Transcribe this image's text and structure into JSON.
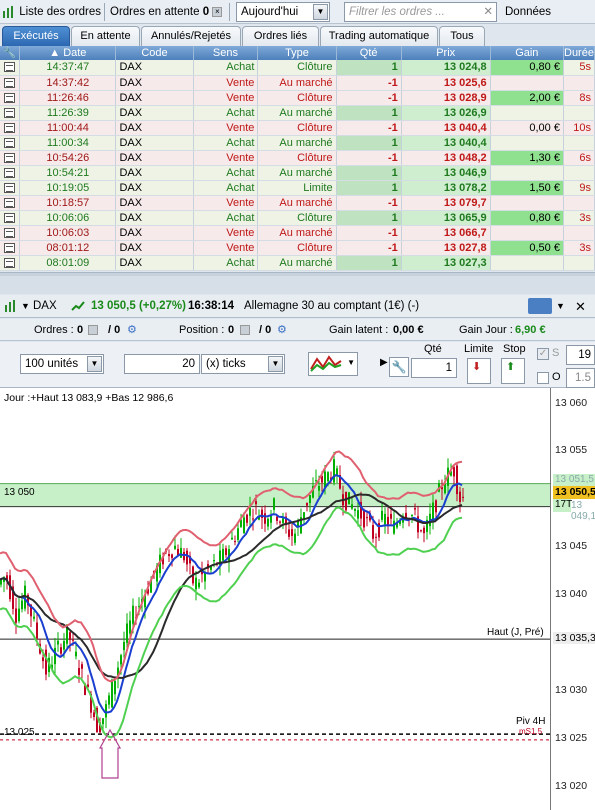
{
  "topbar": {
    "orders_list": "Liste des ordres",
    "pending_label": "Ordres en attente",
    "pending_count": "0",
    "period": "Aujourd'hui",
    "filter_placeholder": "Filtrer les ordres ...",
    "data_label": "Données"
  },
  "tabs": [
    "Exécutés",
    "En attente",
    "Annulés/Rejetés",
    "Ordres liés",
    "Trading automatique",
    "Tous"
  ],
  "table": {
    "headers": [
      "Date",
      "Code",
      "Sens",
      "Type",
      "Qté",
      "Prix",
      "Gain",
      "Durée"
    ],
    "rows": [
      {
        "time": "14:37:47",
        "code": "DAX",
        "dir": "Achat",
        "type": "Clôture",
        "qty": "1",
        "price": "13 024,8",
        "gain": "0,80 €",
        "dur": "5s",
        "side": "buy"
      },
      {
        "time": "14:37:42",
        "code": "DAX",
        "dir": "Vente",
        "type": "Au marché",
        "qty": "-1",
        "price": "13 025,6",
        "gain": "",
        "dur": "",
        "side": "sell"
      },
      {
        "time": "11:26:46",
        "code": "DAX",
        "dir": "Vente",
        "type": "Clôture",
        "qty": "-1",
        "price": "13 028,9",
        "gain": "2,00 €",
        "dur": "8s",
        "side": "sell"
      },
      {
        "time": "11:26:39",
        "code": "DAX",
        "dir": "Achat",
        "type": "Au marché",
        "qty": "1",
        "price": "13 026,9",
        "gain": "",
        "dur": "",
        "side": "buy"
      },
      {
        "time": "11:00:44",
        "code": "DAX",
        "dir": "Vente",
        "type": "Clôture",
        "qty": "-1",
        "price": "13 040,4",
        "gain": "0,00 €",
        "dur": "10s",
        "side": "sell"
      },
      {
        "time": "11:00:34",
        "code": "DAX",
        "dir": "Achat",
        "type": "Au marché",
        "qty": "1",
        "price": "13 040,4",
        "gain": "",
        "dur": "",
        "side": "buy"
      },
      {
        "time": "10:54:26",
        "code": "DAX",
        "dir": "Vente",
        "type": "Clôture",
        "qty": "-1",
        "price": "13 048,2",
        "gain": "1,30 €",
        "dur": "6s",
        "side": "sell"
      },
      {
        "time": "10:54:21",
        "code": "DAX",
        "dir": "Achat",
        "type": "Au marché",
        "qty": "1",
        "price": "13 046,9",
        "gain": "",
        "dur": "",
        "side": "buy"
      },
      {
        "time": "10:19:05",
        "code": "DAX",
        "dir": "Achat",
        "type": "Limite",
        "qty": "1",
        "price": "13 078,2",
        "gain": "1,50 €",
        "dur": "9s",
        "side": "buy"
      },
      {
        "time": "10:18:57",
        "code": "DAX",
        "dir": "Vente",
        "type": "Au marché",
        "qty": "-1",
        "price": "13 079,7",
        "gain": "",
        "dur": "",
        "side": "sell"
      },
      {
        "time": "10:06:06",
        "code": "DAX",
        "dir": "Achat",
        "type": "Clôture",
        "qty": "1",
        "price": "13 065,9",
        "gain": "0,80 €",
        "dur": "3s",
        "side": "buy"
      },
      {
        "time": "10:06:03",
        "code": "DAX",
        "dir": "Vente",
        "type": "Au marché",
        "qty": "-1",
        "price": "13 066,7",
        "gain": "",
        "dur": "",
        "side": "sell"
      },
      {
        "time": "08:01:12",
        "code": "DAX",
        "dir": "Vente",
        "type": "Clôture",
        "qty": "-1",
        "price": "13 027,8",
        "gain": "0,50 €",
        "dur": "3s",
        "side": "sell"
      },
      {
        "time": "08:01:09",
        "code": "DAX",
        "dir": "Achat",
        "type": "Au marché",
        "qty": "1",
        "price": "13 027,3",
        "gain": "",
        "dur": "",
        "side": "buy"
      }
    ]
  },
  "instrument": {
    "name": "DAX",
    "price_change": "13 050,5 (+0,27%)",
    "time": "16:38:14",
    "desc": "Allemagne 30 au comptant (1€) (-)"
  },
  "info": {
    "orders_label": "Ordres :",
    "orders_val": "0",
    "orders_val2": "/ 0",
    "position_label": "Position :",
    "position_val": "0",
    "position_val2": "/ 0",
    "latent_label": "Gain latent :",
    "latent_val": "0,00 €",
    "day_label": "Gain Jour :",
    "day_val": "6,90 €"
  },
  "toolbar": {
    "units": "100 unités",
    "ticks_val": "20",
    "ticks_unit": "(x) ticks",
    "qty_label": "Qté",
    "qty_val": "1",
    "limit_label": "Limite",
    "stop_label": "Stop",
    "s_label": "S",
    "s_val": "19",
    "o_label": "O",
    "o_val": "1.5"
  },
  "chart": {
    "header": "Jour :+Haut 13 083,9 +Bas 12 986,6",
    "price_labels": [
      "13 060",
      "13 055",
      "13 050",
      "13 045",
      "13 040",
      "13 035",
      "13 030",
      "13 025",
      "13 020"
    ],
    "last_price": "13 050,5",
    "band_upper": "13 051,5",
    "band_lower": "13 049,1",
    "timer": "17T",
    "level_13050": "13 050",
    "haut_label": "Haut (J, Pré)",
    "haut_val": "13 035,3",
    "piv_label": "Piv 4H",
    "piv_sub": "mS1,5",
    "level_13025": "13 025",
    "colors": {
      "up": "#00b000",
      "down": "#c00020",
      "ma_blue": "#1a3fd0",
      "ma_dark": "#2a2a2a",
      "st_red": "#e06070",
      "st_green": "#50d050"
    }
  }
}
